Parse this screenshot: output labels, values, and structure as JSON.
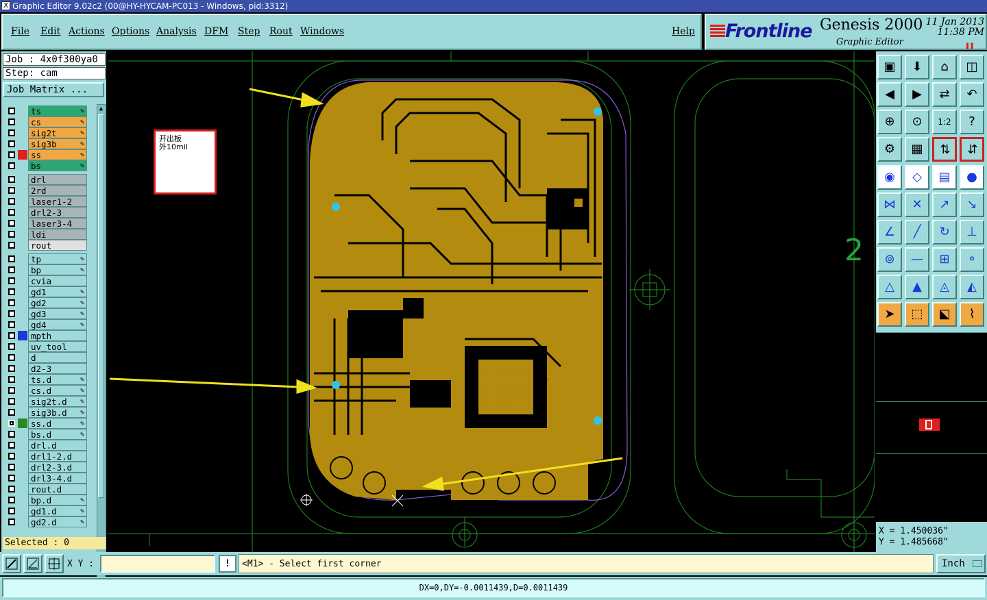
{
  "window": {
    "title": "Graphic Editor 9.02c2 (00@HY-HYCAM-PC013 - Windows, pid:3312)"
  },
  "menu": {
    "items": [
      "File",
      "Edit",
      "Actions",
      "Options",
      "Analysis",
      "DFM",
      "Step",
      "Rout",
      "Windows"
    ],
    "help": "Help"
  },
  "brand": {
    "logo": "Frontline",
    "product": "Genesis 2000",
    "subtitle": "Graphic Editor",
    "date": "11 Jan 2013",
    "time": "11:38 PM"
  },
  "job": {
    "job_text": "Job : 4x0f300ya0",
    "step_text": "Step: cam",
    "matrix_button": "Job Matrix ..."
  },
  "layers": [
    {
      "name": "ts",
      "color": "#2aa870",
      "group": 1,
      "editable": true
    },
    {
      "name": "cs",
      "color": "#f0a845",
      "group": 1,
      "editable": true
    },
    {
      "name": "sig2t",
      "color": "#f0a845",
      "group": 1,
      "editable": true
    },
    {
      "name": "sig3b",
      "color": "#f0a845",
      "group": 1,
      "editable": true
    },
    {
      "name": "ss",
      "color": "#f0a845",
      "group": 1,
      "editable": true,
      "swatch": "#e02020"
    },
    {
      "name": "bs",
      "color": "#2aa870",
      "group": 1,
      "editable": true
    },
    {
      "name": "drl",
      "color": "#a8b5b8",
      "group": 2
    },
    {
      "name": "2rd",
      "color": "#a8b5b8",
      "group": 2
    },
    {
      "name": "laser1-2",
      "color": "#a8b5b8",
      "group": 2
    },
    {
      "name": "drl2-3",
      "color": "#a8b5b8",
      "group": 2
    },
    {
      "name": "laser3-4",
      "color": "#a8b5b8",
      "group": 2
    },
    {
      "name": "ldi",
      "color": "#a8b5b8",
      "group": 2
    },
    {
      "name": "rout",
      "color": "#e0e0e0",
      "group": 2
    },
    {
      "name": "tp",
      "color": "#9fd9d9",
      "group": 3,
      "editable": true
    },
    {
      "name": "bp",
      "color": "#9fd9d9",
      "group": 3,
      "editable": true
    },
    {
      "name": "cvia",
      "color": "#9fd9d9",
      "group": 3
    },
    {
      "name": "gd1",
      "color": "#9fd9d9",
      "group": 3,
      "editable": true
    },
    {
      "name": "gd2",
      "color": "#9fd9d9",
      "group": 3,
      "editable": true
    },
    {
      "name": "gd3",
      "color": "#9fd9d9",
      "group": 3,
      "editable": true
    },
    {
      "name": "gd4",
      "color": "#9fd9d9",
      "group": 3,
      "editable": true
    },
    {
      "name": "mpth",
      "color": "#9fd9d9",
      "group": 3,
      "swatch": "#1a3ad8"
    },
    {
      "name": "uv_tool",
      "color": "#9fd9d9",
      "group": 3
    },
    {
      "name": "d",
      "color": "#9fd9d9",
      "group": 3
    },
    {
      "name": "d2-3",
      "color": "#9fd9d9",
      "group": 3
    },
    {
      "name": "ts.d",
      "color": "#9fd9d9",
      "group": 3,
      "editable": true
    },
    {
      "name": "cs.d",
      "color": "#9fd9d9",
      "group": 3,
      "editable": true
    },
    {
      "name": "sig2t.d",
      "color": "#9fd9d9",
      "group": 3,
      "editable": true
    },
    {
      "name": "sig3b.d",
      "color": "#9fd9d9",
      "group": 3,
      "editable": true
    },
    {
      "name": "ss.d",
      "color": "#9fd9d9",
      "group": 3,
      "editable": true,
      "swatch": "#2a8a20",
      "checked": true
    },
    {
      "name": "bs.d",
      "color": "#9fd9d9",
      "group": 3,
      "editable": true
    },
    {
      "name": "drl.d",
      "color": "#9fd9d9",
      "group": 3
    },
    {
      "name": "drl1-2.d",
      "color": "#9fd9d9",
      "group": 3
    },
    {
      "name": "drl2-3.d",
      "color": "#9fd9d9",
      "group": 3
    },
    {
      "name": "drl3-4.d",
      "color": "#9fd9d9",
      "group": 3
    },
    {
      "name": "rout.d",
      "color": "#9fd9d9",
      "group": 3
    },
    {
      "name": "bp.d",
      "color": "#9fd9d9",
      "group": 3,
      "editable": true
    },
    {
      "name": "gd1.d",
      "color": "#9fd9d9",
      "group": 3,
      "editable": true
    },
    {
      "name": "gd2.d",
      "color": "#9fd9d9",
      "group": 3,
      "editable": true
    }
  ],
  "selected_text": "Selected : 0",
  "annotation_note": "开出板\n外10mil",
  "canvas_label": "2",
  "coords": {
    "x_text": "X = 1.450036\"",
    "y_text": "Y = 1.485668\""
  },
  "bottom": {
    "xy_label": "X Y :",
    "xy_value": "",
    "bang": "!",
    "prompt": "<M1> - Select first corner",
    "units": "Inch"
  },
  "status_text": "DX=0,DY=-0.0011439,D=0.0011439",
  "colors": {
    "copper": "#b38b0f",
    "panel": "#9fd9d9",
    "outline": "#1e7a1e",
    "arrow": "#f0e020"
  }
}
